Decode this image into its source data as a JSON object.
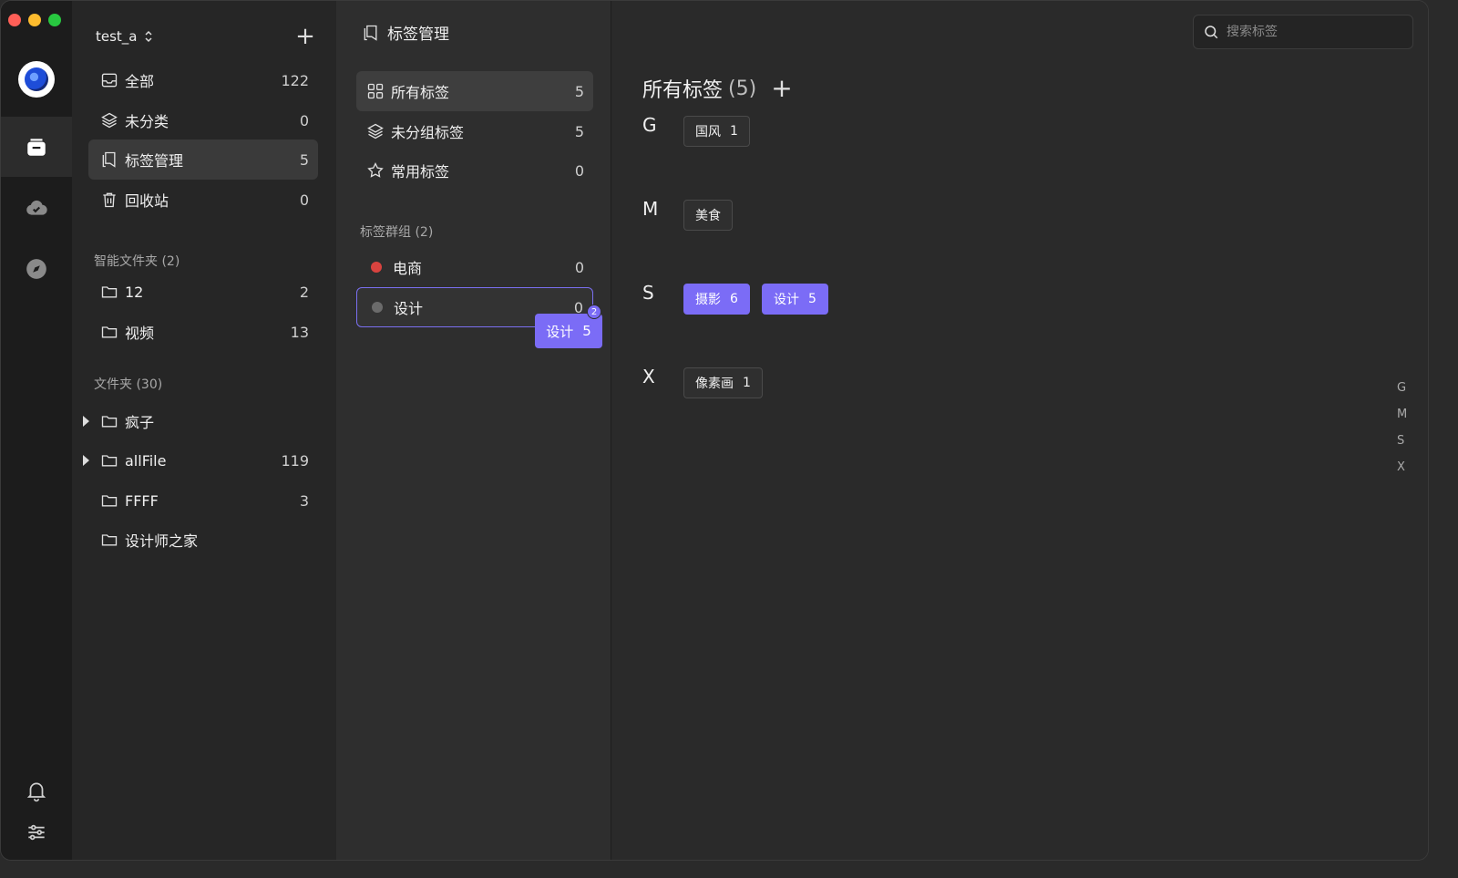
{
  "window_controls": {
    "close_color": "#ff5f57",
    "minimize_color": "#febc2e",
    "zoom_color": "#28c840"
  },
  "rail": {
    "items": [
      {
        "name": "library-icon",
        "active": true
      },
      {
        "name": "cloud-sync-icon",
        "active": false
      },
      {
        "name": "discover-icon",
        "active": false
      }
    ],
    "bottom": [
      "bell-icon",
      "settings-sliders-icon"
    ]
  },
  "sidebar": {
    "library_name": "test_a",
    "main_items": [
      {
        "label": "全部",
        "count": "122",
        "icon": "inbox-icon"
      },
      {
        "label": "未分类",
        "count": "0",
        "icon": "layers-icon"
      },
      {
        "label": "标签管理",
        "count": "5",
        "icon": "tag-icon",
        "active": true
      },
      {
        "label": "回收站",
        "count": "0",
        "icon": "trash-icon"
      }
    ],
    "smart_section": "智能文件夹 (2)",
    "smart_folders": [
      {
        "label": "12",
        "count": "2"
      },
      {
        "label": "视频",
        "count": "13"
      }
    ],
    "folder_section": "文件夹 (30)",
    "folders": [
      {
        "label": "疯子",
        "count": "",
        "expandable": true
      },
      {
        "label": "allFile",
        "count": "119",
        "expandable": true
      },
      {
        "label": "FFFF",
        "count": "3",
        "expandable": false
      },
      {
        "label": "设计师之家",
        "count": "",
        "expandable": false
      }
    ]
  },
  "tagnav": {
    "page_title": "标签管理",
    "items": [
      {
        "label": "所有标签",
        "count": "5",
        "icon": "grid-icon",
        "active": true
      },
      {
        "label": "未分组标签",
        "count": "5",
        "icon": "layers-icon"
      },
      {
        "label": "常用标签",
        "count": "0",
        "icon": "star-icon"
      }
    ],
    "group_section": "标签群组 (2)",
    "groups": [
      {
        "label": "电商",
        "count": "0",
        "color": "#d9433f"
      },
      {
        "label": "设计",
        "count": "0",
        "color": "#6b6b6b"
      }
    ],
    "drag_chip": {
      "label": "设计",
      "count": "5",
      "badge": "2"
    }
  },
  "main": {
    "search_placeholder": "搜索标签",
    "title": "所有标签",
    "title_count": "(5)",
    "add_label": "+",
    "sections": [
      {
        "letter": "G",
        "tags": [
          {
            "name": "国风",
            "count": "1",
            "selected": false
          }
        ]
      },
      {
        "letter": "M",
        "tags": [
          {
            "name": "美食",
            "count": "",
            "selected": false
          }
        ]
      },
      {
        "letter": "S",
        "tags": [
          {
            "name": "摄影",
            "count": "6",
            "selected": true
          },
          {
            "name": "设计",
            "count": "5",
            "selected": true
          }
        ]
      },
      {
        "letter": "X",
        "tags": [
          {
            "name": "像素画",
            "count": "1",
            "selected": false
          }
        ]
      }
    ],
    "index": [
      "G",
      "M",
      "S",
      "X"
    ],
    "accent_color": "#7b6cf6"
  }
}
